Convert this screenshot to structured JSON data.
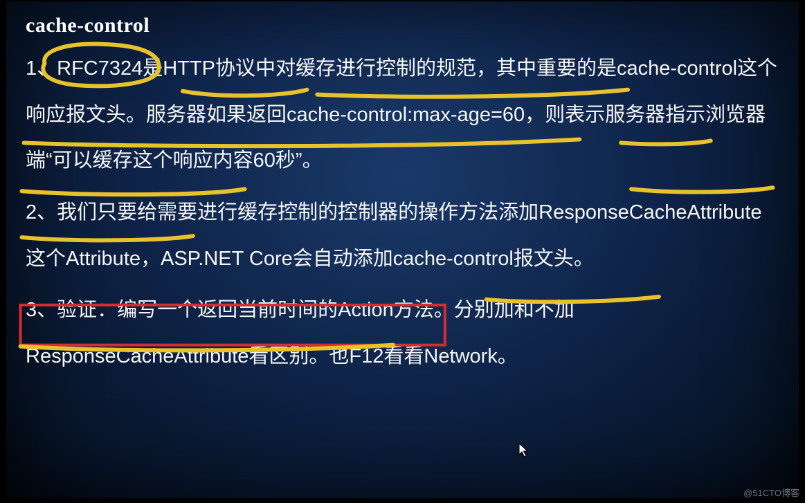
{
  "title": "cache-control",
  "paragraphs": {
    "p1": "1、RFC7324是HTTP协议中对缓存进行控制的规范，其中重要的是cache-control这个响应报文头。服务器如果返回cache-control:max-age=60，则表示服务器指示浏览器端“可以缓存这个响应内容60秒”。",
    "p2": "2、我们只要给需要进行缓存控制的控制器的操作方法添加ResponseCacheAttribute这个Attribute，ASP.NET Core会自动添加cache-control报文头。",
    "p3": "3、验证：编写一个返回当前时间的Action方法。分别加和不加ResponseCacheAttribute看区别。也F12看看Network。"
  },
  "watermark": "@51CTO博客",
  "annotation_colors": {
    "highlight": "#e8c22a",
    "box": "#d62e2e"
  }
}
